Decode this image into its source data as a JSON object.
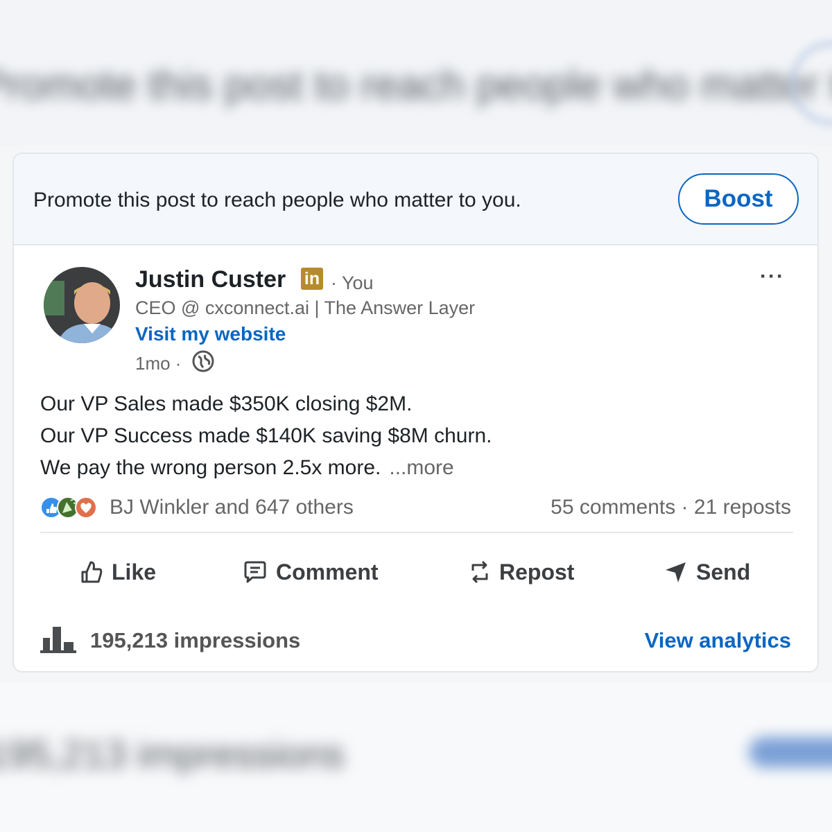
{
  "promo": {
    "text": "Promote this post to reach people who matter to you.",
    "boost_label": "Boost"
  },
  "author": {
    "name": "Justin Custer",
    "badge": "in",
    "you_label": "· You",
    "headline": "CEO @ cxconnect.ai | The Answer Layer",
    "website_label": "Visit my website",
    "time": "1mo ·"
  },
  "post": {
    "lines": [
      "Our VP Sales made $350K closing $2M.",
      "Our VP Success made $140K saving $8M churn.",
      "We pay the wrong person 2.5x more."
    ],
    "more_label": "...more"
  },
  "social": {
    "reactions_text": "BJ Winkler and 647 others",
    "counts_text": "55 comments · 21 reposts",
    "reaction_icons": [
      "like-icon",
      "celebrate-icon",
      "love-icon"
    ]
  },
  "actions": {
    "like": "Like",
    "comment": "Comment",
    "repost": "Repost",
    "send": "Send"
  },
  "analytics": {
    "impressions_text": "195,213 impressions",
    "view_label": "View analytics"
  },
  "colors": {
    "accent": "#0a66c2",
    "badge": "#b58b2c"
  }
}
